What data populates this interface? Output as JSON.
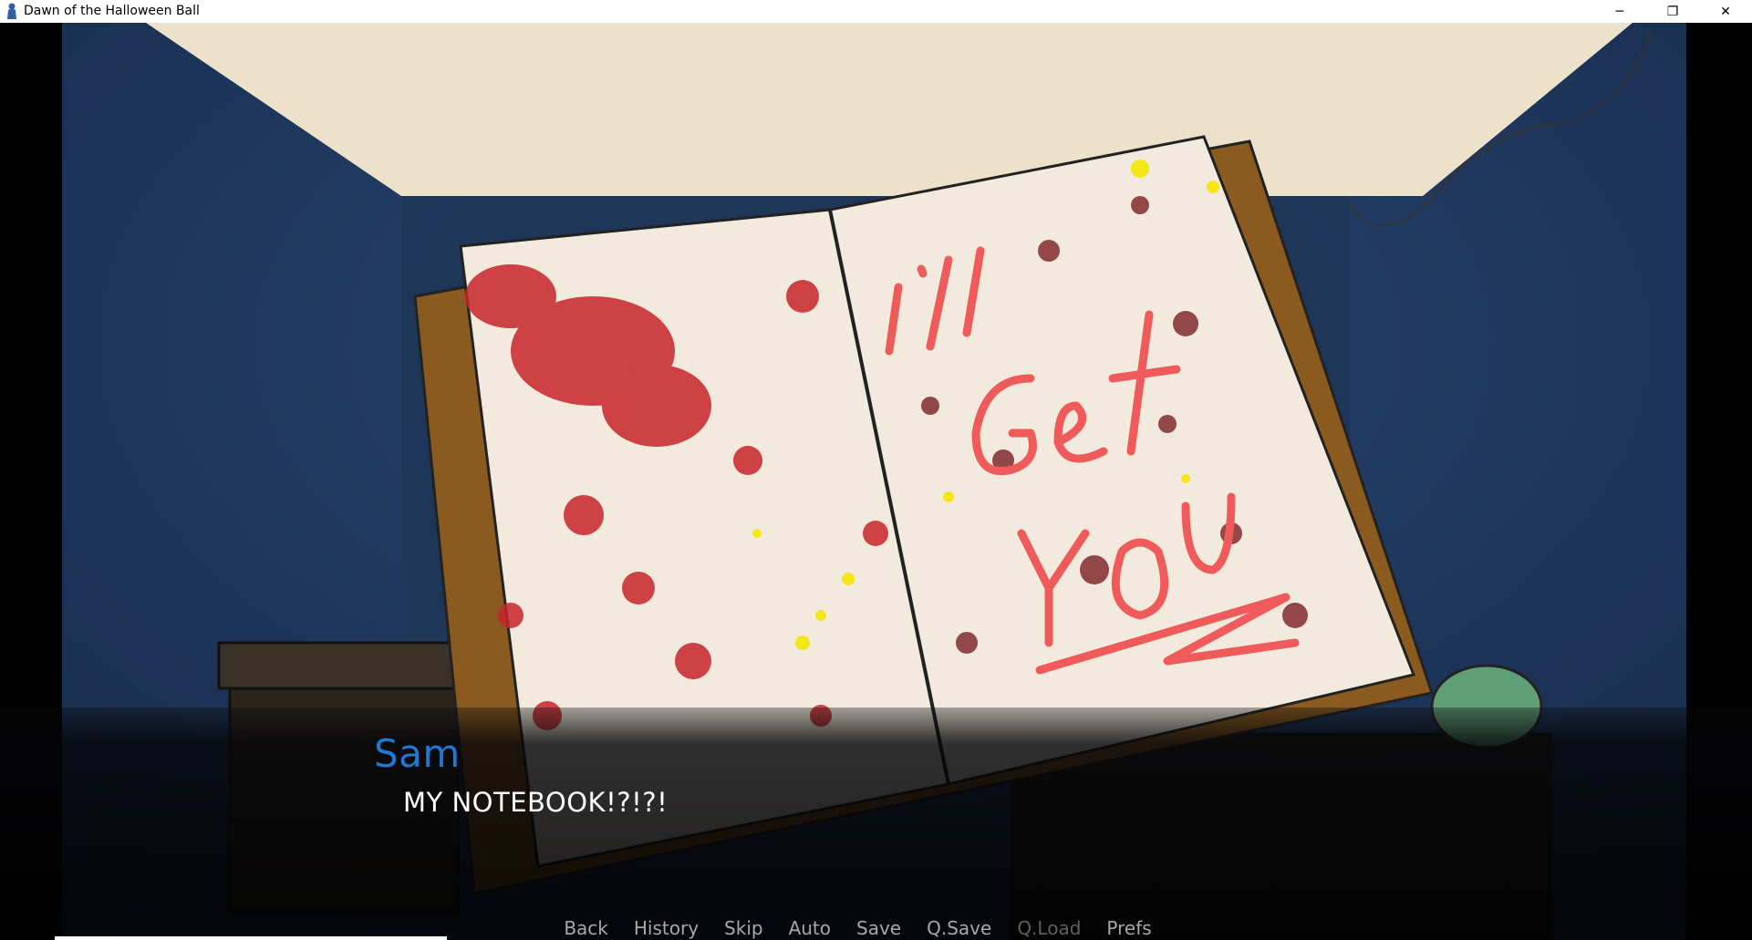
{
  "window": {
    "title": "Dawn of the Halloween Ball",
    "icon": "renpy-icon",
    "controls": {
      "minimize": "─",
      "maximize": "❐",
      "close": "✕"
    }
  },
  "scene": {
    "colors": {
      "wall": "#213a60",
      "ceiling": "#ece2cc",
      "page": "#f2ebdd",
      "cover": "#8a5a1e",
      "blood": "#c8242a",
      "dark_blood": "#7a1e24",
      "yellow": "#f5e61a",
      "scrawl": "#ef5b5b"
    }
  },
  "dialogue": {
    "speaker": "Sam",
    "text": "MY NOTEBOOK!?!?!",
    "speaker_color": "#1f78d1"
  },
  "quick_menu": {
    "items": [
      {
        "label": "Back",
        "enabled": true
      },
      {
        "label": "History",
        "enabled": true
      },
      {
        "label": "Skip",
        "enabled": true
      },
      {
        "label": "Auto",
        "enabled": true
      },
      {
        "label": "Save",
        "enabled": true
      },
      {
        "label": "Q.Save",
        "enabled": true
      },
      {
        "label": "Q.Load",
        "enabled": false
      },
      {
        "label": "Prefs",
        "enabled": true
      }
    ]
  }
}
